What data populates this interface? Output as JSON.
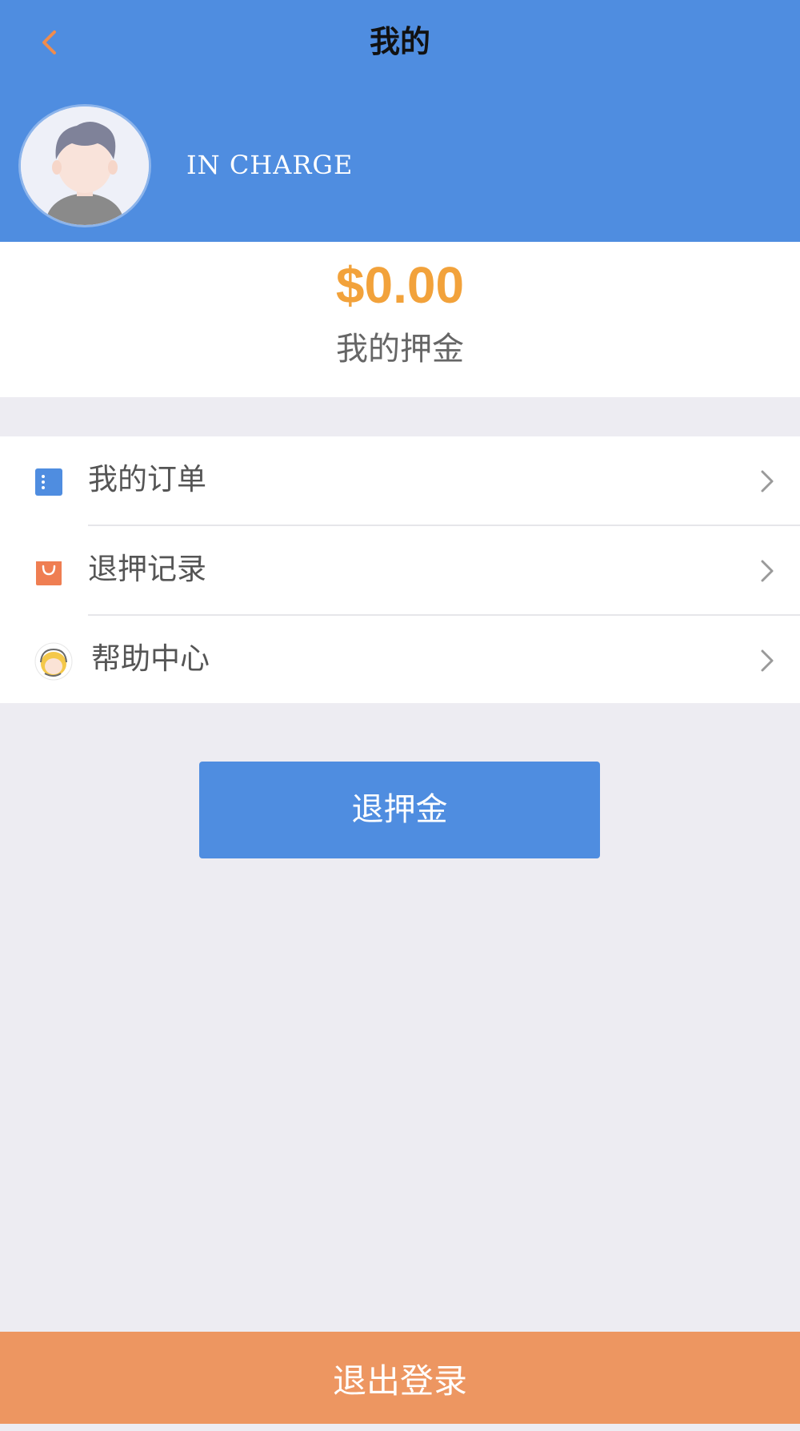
{
  "header": {
    "title": "我的",
    "back_icon": "chevron-left-icon",
    "username": "IN CHARGE",
    "colors": {
      "background": "#4f8de0",
      "back_icon": "#f08c4d"
    }
  },
  "deposit": {
    "amount": "$0.00",
    "label": "我的押金",
    "amount_color": "#f2a23b"
  },
  "menu": {
    "items": [
      {
        "label": "我的订单",
        "icon": "order-list-icon"
      },
      {
        "label": "退押记录",
        "icon": "shopping-bag-icon"
      },
      {
        "label": "帮助中心",
        "icon": "customer-service-icon"
      }
    ]
  },
  "refund_button": {
    "label": "退押金"
  },
  "logout_button": {
    "label": "退出登录",
    "color": "#ed9661"
  }
}
